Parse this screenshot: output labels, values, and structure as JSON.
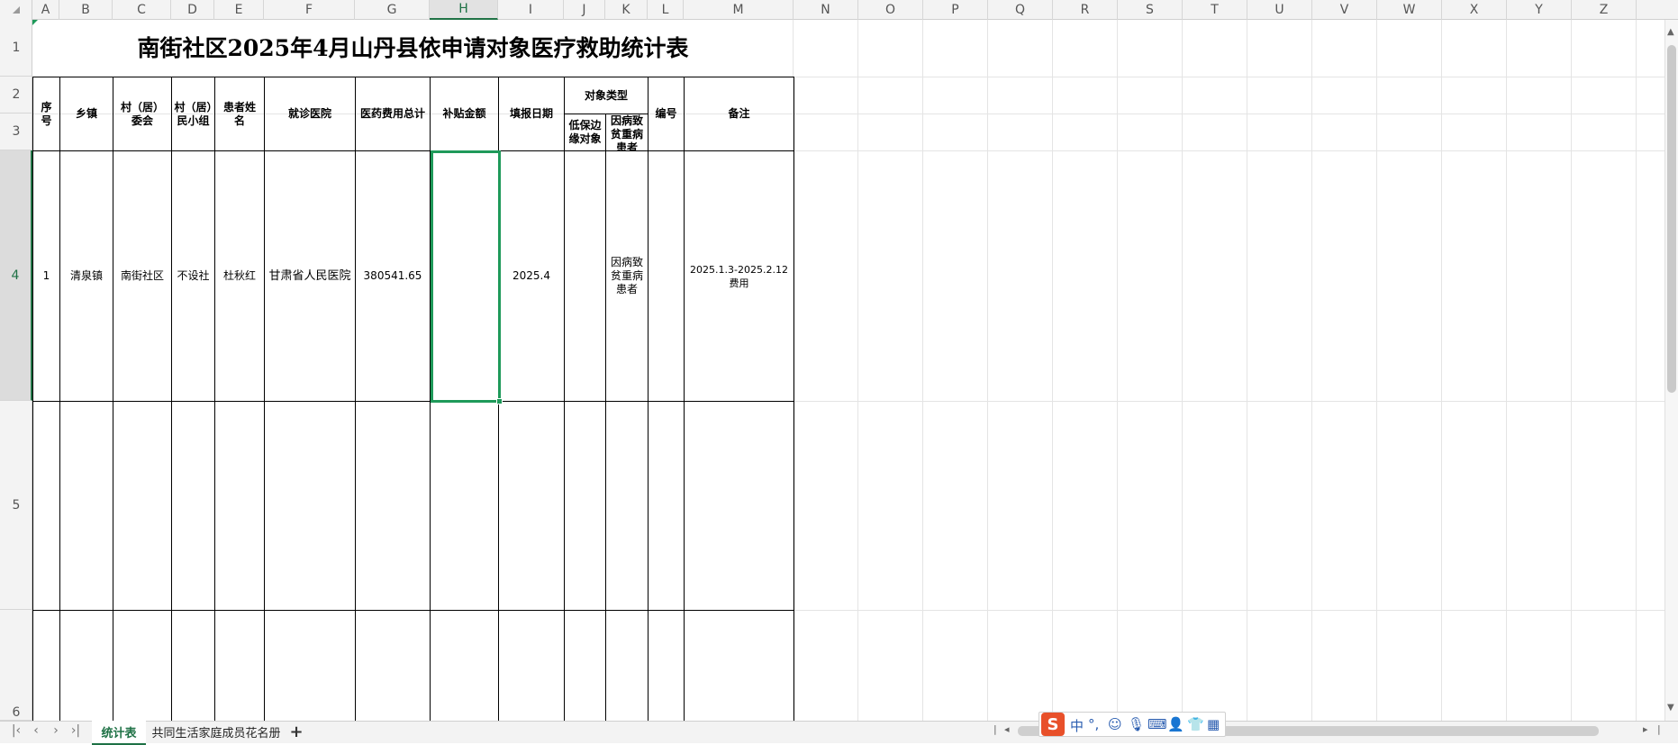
{
  "columns": [
    "A",
    "B",
    "C",
    "D",
    "E",
    "F",
    "G",
    "H",
    "I",
    "J",
    "K",
    "L",
    "M",
    "N",
    "O",
    "P",
    "Q",
    "R",
    "S",
    "T",
    "U",
    "V",
    "W",
    "X",
    "Y",
    "Z"
  ],
  "rows": [
    "1",
    "2",
    "3",
    "4",
    "5",
    "6"
  ],
  "title": "南街社区2025年4月山丹县依申请对象医疗救助统计表",
  "headers": {
    "seq": "序号",
    "town": "乡镇",
    "village": "村（居）委会",
    "group": "村（居）民小组",
    "patient": "患者姓名",
    "hospital": "就诊医院",
    "total_cost": "医药费用总计",
    "subsidy": "补贴金额",
    "report_date": "填报日期",
    "target_type": "对象类型",
    "low_income": "低保边缘对象",
    "illness_poor": "因病致贫重病患者",
    "number": "编号",
    "remarks": "备注"
  },
  "record": {
    "seq": "1",
    "town": "清泉镇",
    "village": "南街社区",
    "group": "不设社",
    "patient": "杜秋红",
    "hospital": "甘肃省人民医院",
    "total_cost": "380541.65",
    "subsidy": "",
    "report_date": "2025.4",
    "low_income": "",
    "illness_poor": "因病致贫重病患者",
    "number": "",
    "remarks": "2025.1.3-2025.2.12费用"
  },
  "sheets": {
    "active": "统计表",
    "second": "共同生活家庭成员花名册",
    "add": "+"
  },
  "ime": {
    "logo": "S",
    "lang": "中",
    "punct": "°,",
    "emoji": "☺",
    "mic": "🎙",
    "keyboard": "⌨",
    "user": "👤",
    "skin": "👕",
    "grid": "▦"
  },
  "selected_cell": "H4",
  "colors": {
    "accent": "#217346",
    "selection": "#1f9a5a"
  }
}
